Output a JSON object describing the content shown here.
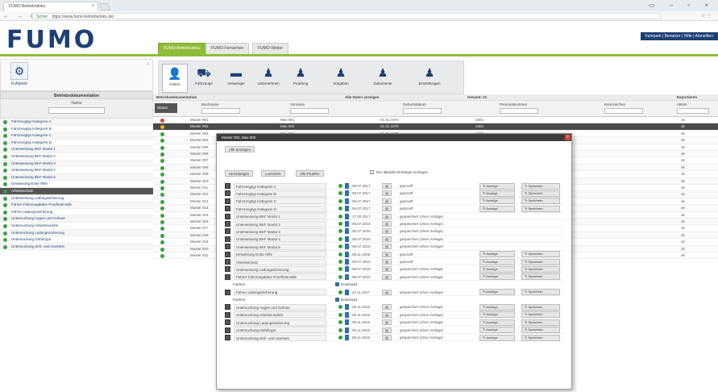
{
  "browser": {
    "tab_title": "FUMO Betriebsdoku",
    "url": "https://www.fumo-betriebsdoku.de/",
    "secure_label": "Sicher"
  },
  "header": {
    "logo_text": "FUMO",
    "tabs": [
      "FUMO-Betriebsdoku",
      "FUMO-Fernsehen",
      "FUMO-Wetter"
    ],
    "user_menu": "Fuhrpark | Benutzer | Hilfe | Abmelden"
  },
  "sidebar": {
    "tool_label": "Fuhrpark",
    "header": "Betriebsdokumentation",
    "filter_label": "Name",
    "items": [
      "Fahrzeugtyp Kategorie A",
      "Fahrzeugtyp Kategorie B",
      "Fahrzeugtyp Kategorie C",
      "Fahrzeugtyp Kategorie D",
      "Unterweisung BKF Modul 1",
      "Unterweisung BKF Modul 2",
      "Unterweisung BKF Modul 3",
      "Unterweisung BKF Modul 4",
      "Unterweisung BKF Modul 5",
      "Einweisung Erste Hilfe",
      "Arbeitsschutz",
      "Unterweisung Ladungssicherung",
      "Fahrer-Fahrzeugdaten Pruefintervalle",
      "Fahrer Ladungssicherung",
      "Untersuchung Augen und Gehoer",
      "Untersuchung Arbeitsmedizin",
      "Untersuchung Ladungssicherung",
      "Untersuchung Gefahrgut",
      "Untersuchung Seh- und Hoertest"
    ]
  },
  "toolbar": {
    "items": [
      "Fahrer",
      "Fahrzeuge",
      "Anhaenger",
      "Unternehmen",
      "Pruefung",
      "Vorgaben",
      "Dokumente",
      "Einstellungen"
    ]
  },
  "table": {
    "meta_left": "Betriebsdokumentation",
    "meta_mid": "Alle Daten anzeigen",
    "meta_right": "Gesamt: 21",
    "meta_btn": "Exportieren",
    "status_header": "Status",
    "columns": [
      "Nachname",
      "Vorname",
      "Geburtsdatum",
      "Personalnummer",
      "Kennzeichen",
      "Aktion"
    ],
    "rows": [
      {
        "name": "Muster 001",
        "vor": "Max 001",
        "dt": "01.01.1970",
        "nr": "1001",
        "k": "ok"
      },
      {
        "name": "Muster 002",
        "vor": "Max 002",
        "dt": "01.01.1970",
        "nr": "1002",
        "k": "ok"
      },
      {
        "name": "Muster 003",
        "vor": "Max 003",
        "dt": "01.01.1970",
        "nr": "1003",
        "k": "ok"
      },
      {
        "name": "Muster 004",
        "vor": "Max 004",
        "dt": "01.01.1970",
        "nr": "1004",
        "k": "ok"
      },
      {
        "name": "Muster 005",
        "vor": "Max 005",
        "dt": "01.01.1970",
        "nr": "1005",
        "k": "ok"
      },
      {
        "name": "Muster 006",
        "vor": "Max 006",
        "dt": "01.01.1970",
        "nr": "1006",
        "k": "ok"
      },
      {
        "name": "Muster 007",
        "vor": "Max 007",
        "dt": "01.01.1970",
        "nr": "1007",
        "k": "ok"
      },
      {
        "name": "Muster 008",
        "vor": "Max 008",
        "dt": "01.01.1970",
        "nr": "1008",
        "k": "ok"
      },
      {
        "name": "Muster 009",
        "vor": "Max 009",
        "dt": "01.01.1970",
        "nr": "1009",
        "k": "ok"
      },
      {
        "name": "Muster 010",
        "vor": "Max 010",
        "dt": "01.01.1970",
        "nr": "1010",
        "k": "ok"
      },
      {
        "name": "Muster 011",
        "vor": "Max 011",
        "dt": "01.01.1970",
        "nr": "1011",
        "k": "ok"
      },
      {
        "name": "Muster 012",
        "vor": "Max 012",
        "dt": "01.01.1970",
        "nr": "1012",
        "k": "ok"
      },
      {
        "name": "Muster 013",
        "vor": "Max 013",
        "dt": "01.01.1970",
        "nr": "1013",
        "k": "ok"
      },
      {
        "name": "Muster 014",
        "vor": "Max 014",
        "dt": "01.01.1970",
        "nr": "1014",
        "k": "ok"
      },
      {
        "name": "Muster 015",
        "vor": "Max 015",
        "dt": "01.01.1970",
        "nr": "1015",
        "k": "ok"
      },
      {
        "name": "Muster 016",
        "vor": "Max 016",
        "dt": "01.01.1970",
        "nr": "1016",
        "k": "ok"
      },
      {
        "name": "Muster 017",
        "vor": "Max 017",
        "dt": "01.01.1970",
        "nr": "1017",
        "k": "ok"
      },
      {
        "name": "Muster 018",
        "vor": "Max 018",
        "dt": "01.01.1970",
        "nr": "1018",
        "k": "ok"
      },
      {
        "name": "Muster 019",
        "vor": "Max 019",
        "dt": "01.01.1970",
        "nr": "1019",
        "k": "ok"
      },
      {
        "name": "Muster 020",
        "vor": "Max 020",
        "dt": "01.01.1970",
        "nr": "1020",
        "k": "ok"
      },
      {
        "name": "Muster 021",
        "vor": "Max 021",
        "dt": "01.01.1970",
        "nr": "1021",
        "k": "ok"
      }
    ]
  },
  "modal": {
    "title": "Muster 002, Max 002",
    "top_button": "Alle anzeigen",
    "btn_a": "Hinzufuegen",
    "btn_b": "Loeschen",
    "btn_c": "Alle Pruefen",
    "checkbox_label": "Nur aktuelle Eintraege anzeigen",
    "rows": [
      {
        "nm": "Fahrzeugtyp Kategorie A",
        "dt": "06.07.2017",
        "st": "geprueft",
        "b1": "Anzeige",
        "b2": "Speichern"
      },
      {
        "nm": "Fahrzeugtyp Kategorie B",
        "dt": "06.07.2017",
        "st": "geprueft",
        "b1": "Anzeige",
        "b2": "Speichern"
      },
      {
        "nm": "Fahrzeugtyp Kategorie C",
        "dt": "06.07.2017",
        "st": "geprueft",
        "b1": "Anzeige",
        "b2": "Speichern"
      },
      {
        "nm": "Fahrzeugtyp Kategorie D",
        "dt": "06.07.2017",
        "st": "geprueft",
        "b1": "Anzeige",
        "b2": "Speichern"
      },
      {
        "nm": "Unterweisung BKF Modul 1",
        "dt": "17.02.2017",
        "st": "gespeichert (ohne Vorlage)",
        "b1": "",
        "b2": ""
      },
      {
        "nm": "Unterweisung BKF Modul 2",
        "dt": "06.07.2016",
        "st": "gespeichert (ohne Vorlage)",
        "b1": "",
        "b2": ""
      },
      {
        "nm": "Unterweisung BKF Modul 3",
        "dt": "06.07.2016",
        "st": "gespeichert (ohne Vorlage)",
        "b1": "",
        "b2": ""
      },
      {
        "nm": "Unterweisung BKF Modul 4",
        "dt": "06.07.2016",
        "st": "gespeichert (ohne Vorlage)",
        "b1": "",
        "b2": ""
      },
      {
        "nm": "Unterweisung BKF Modul 5",
        "dt": "06.07.2016",
        "st": "gespeichert (ohne Vorlage)",
        "b1": "",
        "b2": ""
      },
      {
        "nm": "Einweisung Erste Hilfe",
        "dt": "09.11.2008",
        "st": "geprueft",
        "b1": "Anzeige",
        "b2": "Speichern"
      },
      {
        "nm": "Arbeitsschutz",
        "dt": "06.07.2016",
        "st": "geprueft",
        "b1": "Anzeige",
        "b2": "Speichern"
      },
      {
        "nm": "Unterweisung Ladungssicherung",
        "dt": "06.07.2016",
        "st": "gespeichert (ohne Vorlage)",
        "b1": "Anzeige",
        "b2": "Speichern"
      },
      {
        "nm": "Fahrer-Fahrzeugdaten Pruefintervalle",
        "dt": "06.07.2016",
        "st": "gespeichert (ohne Vorlage)",
        "b1": "Anzeige",
        "b2": "Speichern"
      }
    ],
    "sub1_label": "Fuehrer",
    "sub1_value": "Download",
    "mid_row": {
      "nm": "Fahrer Ladungssicherung",
      "dt": "24.11.2017",
      "st": "gespeichert (ohne Vorlage)",
      "b1": "Anzeige",
      "b2": "Speichern"
    },
    "sub2_label": "Fuehrer",
    "sub2_value": "Download",
    "bottom_rows": [
      {
        "nm": "Untersuchung Augen und Gehoer",
        "dt": "09.11.2016",
        "st": "gespeichert (ohne Vorlage)",
        "b1": "Anzeige",
        "b2": "Speichern"
      },
      {
        "nm": "Untersuchung Arbeitsmedizin",
        "dt": "09.11.2016",
        "st": "gespeichert (ohne Vorlage)",
        "b1": "Anzeige",
        "b2": "Speichern"
      },
      {
        "nm": "Untersuchung Ladungssicherung",
        "dt": "09.11.2016",
        "st": "gespeichert (ohne Vorlage)",
        "b1": "Anzeige",
        "b2": "Speichern"
      },
      {
        "nm": "Untersuchung Gefahrgut",
        "dt": "09.11.2016",
        "st": "gespeichert (ohne Vorlage)",
        "b1": "Anzeige",
        "b2": "Speichern"
      },
      {
        "nm": "Untersuchung Seh- und Hoertest",
        "dt": "09.11.2016",
        "st": "gespeichert (ohne Vorlage)",
        "b1": "Anzeige",
        "b2": "Speichern"
      }
    ]
  },
  "colors": {
    "brand_blue": "#1c3f75",
    "accent_green": "#8fbc3a",
    "status_green": "#3aa041",
    "status_red": "#d9432f",
    "status_yellow": "#e8b824"
  }
}
